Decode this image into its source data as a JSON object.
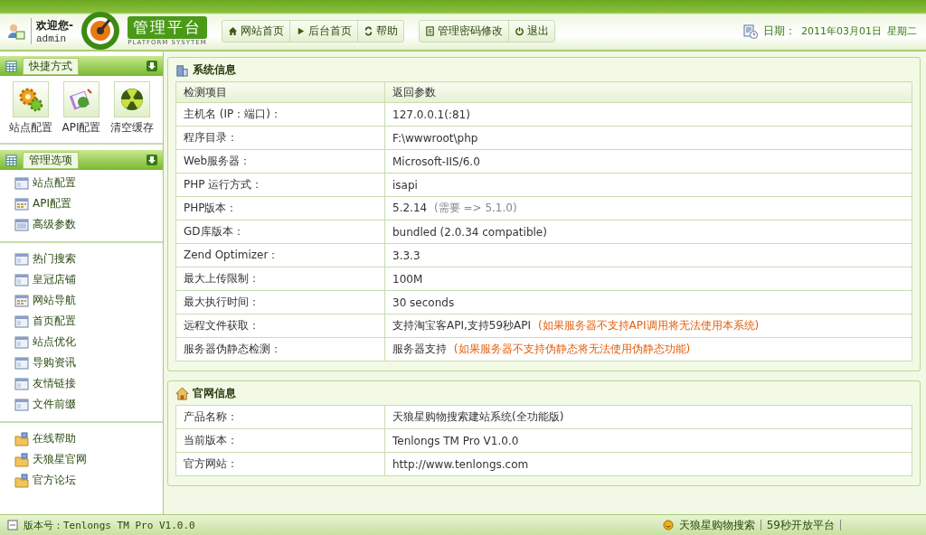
{
  "header": {
    "welcome": "欢迎您-",
    "user": "admin",
    "logo_title": "管理平台",
    "logo_subtitle": "PLATFORM SYSYTEM",
    "nav": [
      {
        "label": "网站首页",
        "kind": "home"
      },
      {
        "label": "后台首页",
        "kind": "play"
      },
      {
        "label": "帮助",
        "kind": "refresh"
      }
    ],
    "nav2": [
      {
        "label": "管理密码修改",
        "kind": "doc"
      },
      {
        "label": "退出",
        "kind": "power"
      }
    ],
    "date_label": "日期：",
    "date": "2011年03月01日",
    "weekday": "星期二"
  },
  "sidebar": {
    "sections": [
      {
        "title": "快捷方式",
        "kind": "shortcuts",
        "items": [
          {
            "label": "站点配置",
            "kind": "gears"
          },
          {
            "label": "API配置",
            "kind": "clipboard"
          },
          {
            "label": "清空缓存",
            "kind": "radiation"
          }
        ]
      },
      {
        "title": "管理选项",
        "kind": "list",
        "groups": [
          [
            {
              "label": "站点配置",
              "kind": "page"
            },
            {
              "label": "API配置",
              "kind": "grid"
            },
            {
              "label": "高级参数",
              "kind": "list"
            }
          ],
          [
            {
              "label": "热门搜索",
              "kind": "page"
            },
            {
              "label": "皇冠店铺",
              "kind": "page"
            },
            {
              "label": "网站导航",
              "kind": "grid"
            },
            {
              "label": "首页配置",
              "kind": "page"
            },
            {
              "label": "站点优化",
              "kind": "page"
            },
            {
              "label": "导购资讯",
              "kind": "page"
            },
            {
              "label": "友情链接",
              "kind": "page"
            },
            {
              "label": "文件前缀",
              "kind": "page"
            }
          ],
          [
            {
              "label": "在线帮助",
              "kind": "folder"
            },
            {
              "label": "天狼星官网",
              "kind": "folder"
            },
            {
              "label": "官方论坛",
              "kind": "folder"
            }
          ]
        ]
      }
    ]
  },
  "panels": [
    {
      "title": "系统信息",
      "kind": "building",
      "columns": [
        "检测项目",
        "返回参数"
      ],
      "rows": [
        {
          "item": "主机名 (IP：端口)：",
          "value": "127.0.0.1(:81)"
        },
        {
          "item": "程序目录：",
          "value": "F:\\wwwroot\\php"
        },
        {
          "item": "Web服务器：",
          "value": "Microsoft-IIS/6.0"
        },
        {
          "item": "PHP 运行方式：",
          "value": "isapi"
        },
        {
          "item": "PHP版本：",
          "value": "5.2.14",
          "note": "(需要 => 5.1.0)",
          "kind": "hint"
        },
        {
          "item": "GD库版本：",
          "value": "bundled (2.0.34 compatible)"
        },
        {
          "item": "Zend Optimizer：",
          "value": "3.3.3"
        },
        {
          "item": "最大上传限制：",
          "value": "100M"
        },
        {
          "item": "最大执行时间：",
          "value": "30 seconds"
        },
        {
          "item": "远程文件获取：",
          "value": "支持淘宝客API,支持59秒API",
          "note": "(如果服务器不支持API调用将无法使用本系统)",
          "kind": "warning"
        },
        {
          "item": "服务器伪静态检测：",
          "value": "服务器支持",
          "note": "(如果服务器不支持伪静态将无法使用伪静态功能)",
          "kind": "warning"
        }
      ]
    },
    {
      "title": "官网信息",
      "kind": "house",
      "rows": [
        {
          "item": "产品名称：",
          "value": "天狼星购物搜索建站系统(全功能版)"
        },
        {
          "item": "当前版本：",
          "value": "Tenlongs TM Pro V1.0.0"
        },
        {
          "item": "官方网站：",
          "value": "http://www.tenlongs.com"
        }
      ]
    }
  ],
  "status_bar": {
    "version": "版本号：Tenlongs TM Pro V1.0.0",
    "links": [
      "天狼星购物搜索",
      "59秒开放平台"
    ]
  }
}
